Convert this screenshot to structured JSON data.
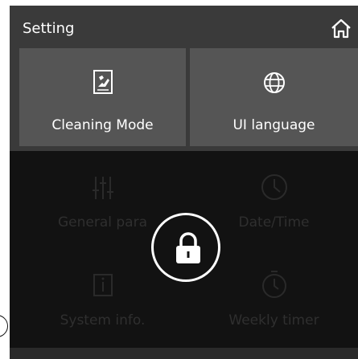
{
  "header": {
    "title": "Setting",
    "home_icon": "home-icon"
  },
  "tiles": [
    {
      "label": "Cleaning Mode",
      "icon": "cleaning-mode-icon"
    },
    {
      "label": "UI language",
      "icon": "globe-icon"
    }
  ],
  "dim_tiles": [
    {
      "label": "General para",
      "icon": "sliders-icon"
    },
    {
      "label": "Date/Time",
      "icon": "clock-icon"
    },
    {
      "label": "System info.",
      "icon": "info-icon"
    },
    {
      "label": "Weekly timer",
      "icon": "timer-icon"
    }
  ],
  "lock": {
    "icon": "lock-icon"
  },
  "colors": {
    "screen_bg": "#3a3a3a",
    "tile_bg": "#555555",
    "overlay_bg": "#121212",
    "text": "#ffffff"
  }
}
